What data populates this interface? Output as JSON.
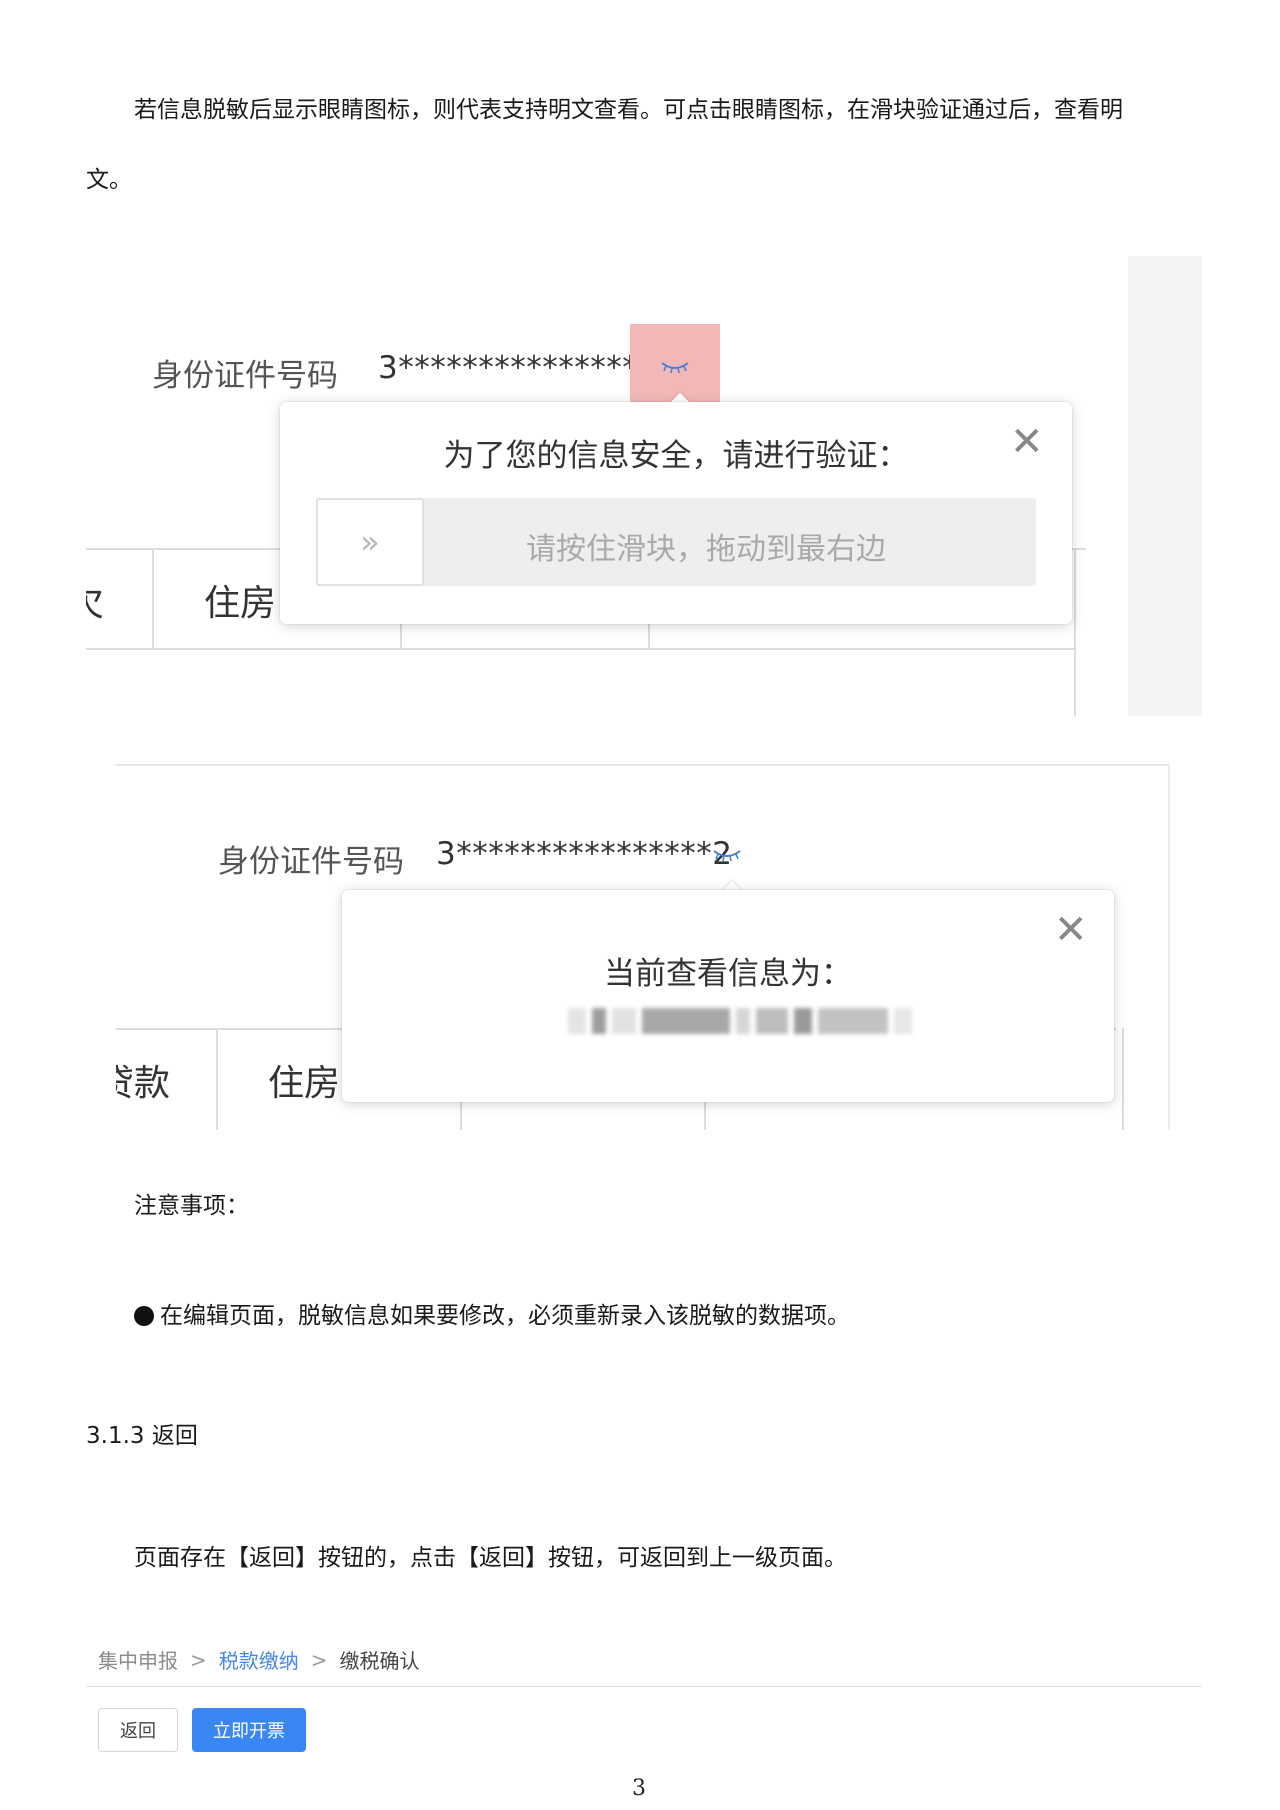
{
  "intro": {
    "line1": "若信息脱敏后显示眼睛图标，则代表支持明文查看。可点击眼睛图标，在滑块验证通过后，查看明",
    "line2": "文。"
  },
  "screenshot1": {
    "id_label": "身份证件号码",
    "id_value": "3****************2",
    "eye_icon": "eye-closed-icon",
    "popup_title": "为了您的信息安全，请进行验证：",
    "slider_text": "请按住滑块，拖动到最右边",
    "slider_handle_icon": "double-chevron-right-icon",
    "table_cells": [
      "欠",
      "住房"
    ]
  },
  "screenshot2": {
    "id_label": "身份证件号码",
    "id_value": "3****************2",
    "popup_title": "当前查看信息为：",
    "table_cells": [
      "贷款",
      "住房"
    ]
  },
  "notes": {
    "heading": "注意事项：",
    "bullet": "在编辑页面，脱敏信息如果要修改，必须重新录入该脱敏的数据项。"
  },
  "section": {
    "title": "3.1.3 返回",
    "text": "页面存在【返回】按钮的，点击【返回】按钮，可返回到上一级页面。"
  },
  "breadcrumb": {
    "items": [
      "集中申报",
      "税款缴纳",
      "缴税确认"
    ],
    "separator": ">"
  },
  "buttons": {
    "back": "返回",
    "invoice": "立即开票"
  },
  "page_number": "3",
  "colors": {
    "accent": "#3b86f5",
    "link": "#4a86e8",
    "highlight": "#f2b8b8"
  }
}
